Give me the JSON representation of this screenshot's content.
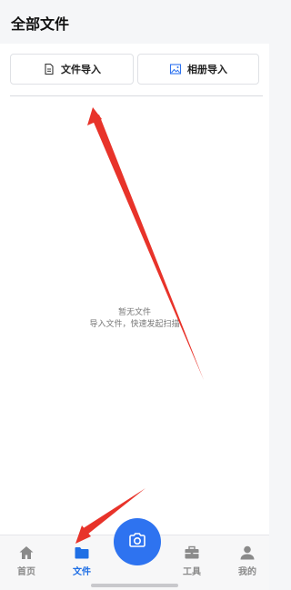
{
  "header": {
    "title": "全部文件"
  },
  "toolbar": {
    "file_import_label": "文件导入",
    "file_import_icon": "document-icon",
    "album_import_label": "相册导入",
    "album_import_icon": "image-icon"
  },
  "empty_state": {
    "title": "暂无文件",
    "subtitle": "导入文件，快速发起扫描"
  },
  "tabbar": {
    "tabs": [
      {
        "label": "首页",
        "icon": "home-icon",
        "active": false
      },
      {
        "label": "文件",
        "icon": "folder-icon",
        "active": true
      },
      {
        "label": "工具",
        "icon": "toolbox-icon",
        "active": false
      },
      {
        "label": "我的",
        "icon": "user-icon",
        "active": false
      }
    ],
    "center_action_icon": "camera-icon"
  },
  "colors": {
    "accent": "#2e73f0",
    "active_tab": "#1f6fe5",
    "inactive_tab": "#8a8a8a",
    "annotation_arrow": "#e8332a"
  }
}
